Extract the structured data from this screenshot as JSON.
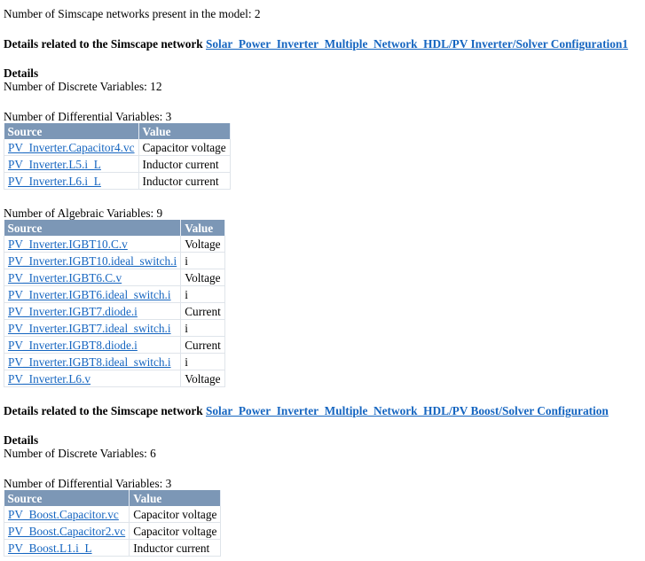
{
  "summary": "Number of Simscape networks present in the model: 2",
  "networks": [
    {
      "heading_prefix": "Details related to the Simscape network ",
      "link": "Solar_Power_Inverter_Multiple_Network_HDL/PV Inverter/Solver Configuration1",
      "details_label": "Details",
      "discrete": "Number of Discrete Variables: 12",
      "differential": "Number of Differential Variables: 3",
      "algebraic": "Number of Algebraic Variables: 9",
      "col_source": "Source",
      "col_value": "Value"
    },
    {
      "heading_prefix": "Details related to the Simscape network ",
      "link": "Solar_Power_Inverter_Multiple_Network_HDL/PV Boost/Solver Configuration",
      "details_label": "Details",
      "discrete": "Number of Discrete Variables: 6",
      "differential": "Number of Differential Variables: 3",
      "col_source": "Source",
      "col_value": "Value"
    }
  ],
  "tables": {
    "n1_differential": [
      {
        "source": "PV_Inverter.Capacitor4.vc",
        "value": "Capacitor voltage"
      },
      {
        "source": "PV_Inverter.L5.i_L",
        "value": "Inductor current"
      },
      {
        "source": "PV_Inverter.L6.i_L",
        "value": "Inductor current"
      }
    ],
    "n1_algebraic": [
      {
        "source": "PV_Inverter.IGBT10.C.v",
        "value": "Voltage"
      },
      {
        "source": "PV_Inverter.IGBT10.ideal_switch.i",
        "value": "i"
      },
      {
        "source": "PV_Inverter.IGBT6.C.v",
        "value": "Voltage"
      },
      {
        "source": "PV_Inverter.IGBT6.ideal_switch.i",
        "value": "i"
      },
      {
        "source": "PV_Inverter.IGBT7.diode.i",
        "value": "Current"
      },
      {
        "source": "PV_Inverter.IGBT7.ideal_switch.i",
        "value": "i"
      },
      {
        "source": "PV_Inverter.IGBT8.diode.i",
        "value": "Current"
      },
      {
        "source": "PV_Inverter.IGBT8.ideal_switch.i",
        "value": "i"
      },
      {
        "source": "PV_Inverter.L6.v",
        "value": "Voltage"
      }
    ],
    "n2_differential": [
      {
        "source": "PV_Boost.Capacitor.vc",
        "value": "Capacitor voltage"
      },
      {
        "source": "PV_Boost.Capacitor2.vc",
        "value": "Capacitor voltage"
      },
      {
        "source": "PV_Boost.L1.i_L",
        "value": "Inductor current"
      }
    ]
  }
}
